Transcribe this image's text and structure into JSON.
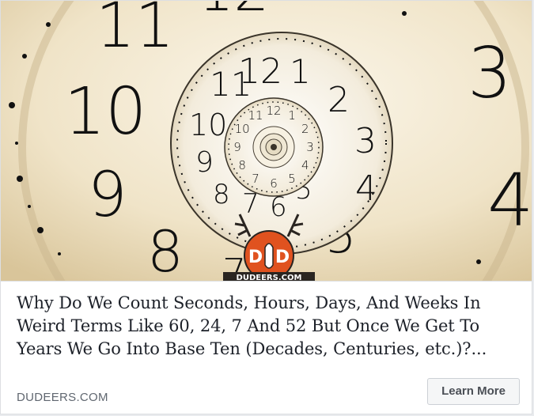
{
  "hero": {
    "outer_numerals": [
      "11",
      "12",
      "3",
      "10",
      "9",
      "8",
      "7",
      "5",
      "4"
    ],
    "middle_numerals": [
      "11",
      "12",
      "1",
      "2",
      "3",
      "10",
      "9",
      "8",
      "7",
      "6",
      "5",
      "4"
    ],
    "inner_numerals": [
      "12",
      "1",
      "2",
      "3",
      "4",
      "5",
      "6",
      "7",
      "8",
      "9",
      "10",
      "11"
    ],
    "logo_letters": [
      "D",
      "D"
    ],
    "logo_caption": "DUDEERS.COM"
  },
  "post": {
    "headline": "Why Do We Count Seconds, Hours, Days, And Weeks In Weird Terms Like 60, 24, 7 And 52 But Once We Get To Years We Go Into Base Ten (Decades, Centuries, etc.)?...",
    "domain": "DUDEERS.COM",
    "cta_label": "Learn More"
  },
  "colors": {
    "headline": "#1d2129",
    "domain": "#606770",
    "button_bg": "#f5f6f7",
    "logo_orange": "#e0521f"
  }
}
